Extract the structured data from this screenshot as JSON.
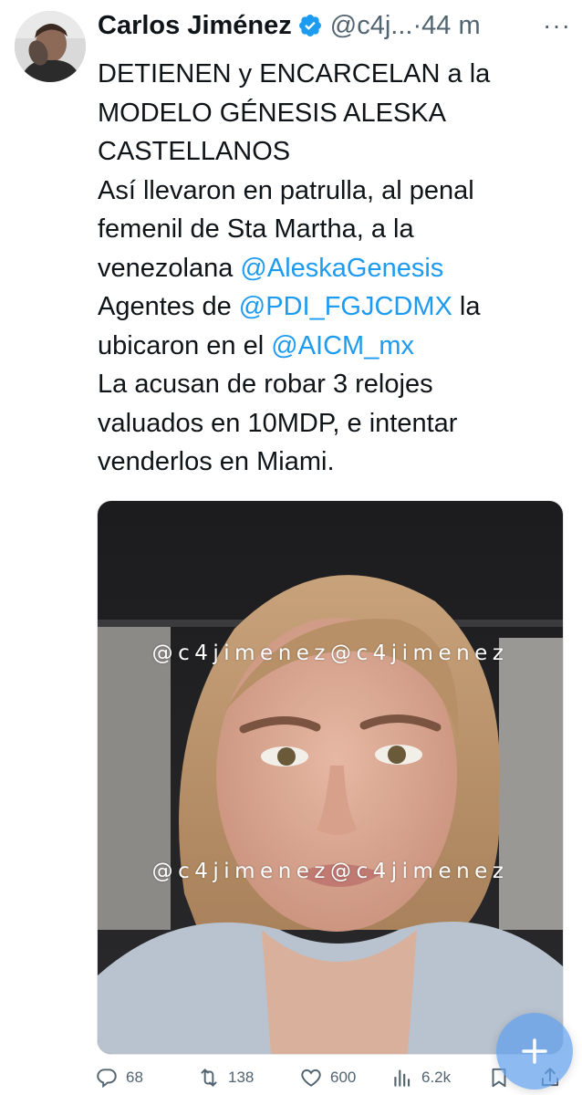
{
  "tweet": {
    "author": {
      "display_name": "Carlos Jiménez",
      "handle": "@c4j...",
      "verified": true,
      "avatar_icon": "avatar-photo"
    },
    "separator": "·",
    "time": "44 m",
    "more_icon": "more-horizontal-icon",
    "more_label": "···",
    "text_lines": [
      [
        {
          "t": "DETIENEN y ENCARCELAN a la"
        }
      ],
      [
        {
          "t": "MODELO GÉNESIS ALESKA"
        }
      ],
      [
        {
          "t": "CASTELLANOS"
        }
      ],
      [
        {
          "t": "Así llevaron en patrulla, al penal"
        }
      ],
      [
        {
          "t": "femenil de Sta Martha, a la"
        }
      ],
      [
        {
          "t": "venezolana "
        },
        {
          "t": "@AleskaGenesis",
          "mention": true
        }
      ],
      [
        {
          "t": "Agentes de "
        },
        {
          "t": "@PDI_FGJCDMX",
          "mention": true
        },
        {
          "t": " la"
        }
      ],
      [
        {
          "t": "ubicaron en el "
        },
        {
          "t": "@AICM_mx",
          "mention": true
        }
      ],
      [
        {
          "t": "La acusan de robar 3 relojes"
        }
      ],
      [
        {
          "t": "valuados en 10MDP, e intentar"
        }
      ],
      [
        {
          "t": "venderlos en Miami."
        }
      ]
    ],
    "media": {
      "watermark_top": "@c4jimenez@c4jimenez",
      "watermark_bottom": "@c4jimenez@c4jimenez"
    },
    "metrics": {
      "replies": "68",
      "retweets": "138",
      "likes": "600",
      "views": "6.2k"
    }
  },
  "colors": {
    "accent": "#1d9bf0",
    "text": "#0f1419",
    "secondary": "#536471"
  },
  "fab_icon": "compose-plus-icon"
}
